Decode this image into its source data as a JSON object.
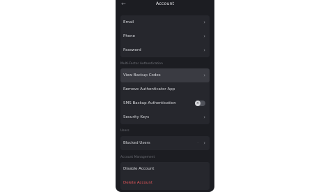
{
  "header": {
    "title": "Account",
    "back_glyph": "←"
  },
  "account": {
    "items": [
      {
        "label": "Email"
      },
      {
        "label": "Phone"
      },
      {
        "label": "Password"
      }
    ]
  },
  "mfa": {
    "section_label": "Multi-Factor Authentication",
    "items": [
      {
        "label": "View Backup Codes"
      },
      {
        "label": "Remove Authenticator App"
      },
      {
        "label": "SMS Backup Authentication",
        "toggle": false
      },
      {
        "label": "Security Keys"
      }
    ]
  },
  "users": {
    "section_label": "Users",
    "items": [
      {
        "label": "Blocked Users",
        "count": "·"
      }
    ]
  },
  "management": {
    "section_label": "Account Management",
    "items": [
      {
        "label": "Disable Account"
      },
      {
        "label": "Delete Account",
        "color": "#e0565a"
      }
    ]
  },
  "glyphs": {
    "chevron": "›",
    "toggle_off": "×"
  }
}
